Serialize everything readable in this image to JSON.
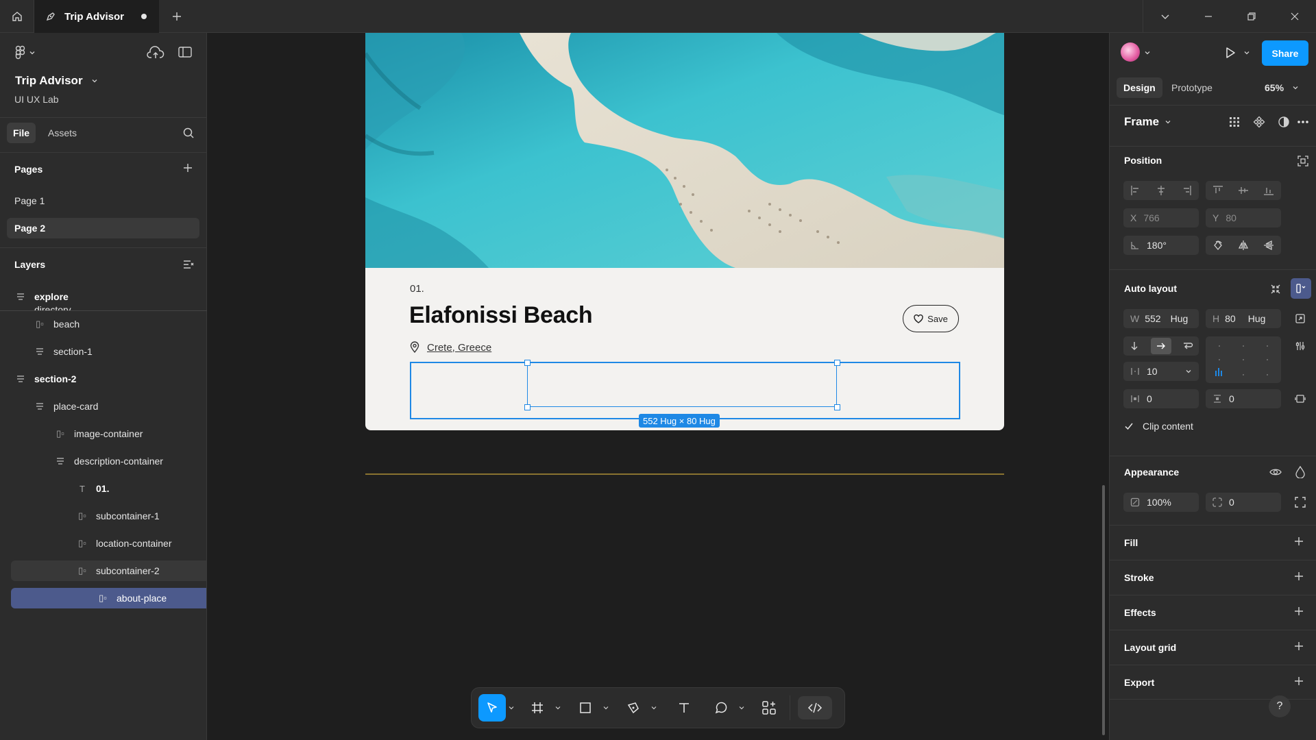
{
  "tab": {
    "title": "Trip Advisor"
  },
  "left_panel": {
    "project_name": "Trip Advisor",
    "team_name": "UI UX Lab",
    "file_tab": "File",
    "assets_tab": "Assets",
    "pages_heading": "Pages",
    "pages": [
      {
        "label": "Page 1",
        "active": false
      },
      {
        "label": "Page 2",
        "active": true
      }
    ],
    "layers_heading": "Layers",
    "layers": [
      {
        "label": "explore",
        "icon": "frame-icon"
      },
      {
        "label": "directory",
        "icon": "frame-icon"
      },
      {
        "label": "beach",
        "icon": "autolayout-icon"
      },
      {
        "label": "section-1",
        "icon": "frame-icon"
      },
      {
        "label": "section-2",
        "icon": "frame-icon"
      },
      {
        "label": "place-card",
        "icon": "frame-icon"
      },
      {
        "label": "image-container",
        "icon": "autolayout-icon"
      },
      {
        "label": "description-container",
        "icon": "frame-icon"
      },
      {
        "label": "01.",
        "icon": "text-icon"
      },
      {
        "label": "subcontainer-1",
        "icon": "autolayout-icon"
      },
      {
        "label": "location-container",
        "icon": "autolayout-icon"
      },
      {
        "label": "subcontainer-2",
        "icon": "autolayout-icon"
      },
      {
        "label": "about-place",
        "icon": "autolayout-icon"
      }
    ]
  },
  "canvas": {
    "card_number": "01.",
    "card_title": "Elafonissi Beach",
    "location": "Crete, Greece",
    "save_label": "Save",
    "size_badge": "552 Hug × 80 Hug"
  },
  "right_panel": {
    "share_label": "Share",
    "design_tab": "Design",
    "prototype_tab": "Prototype",
    "zoom": "65%",
    "frame_label": "Frame",
    "position_heading": "Position",
    "x_label": "X",
    "x_value": "766",
    "y_label": "Y",
    "y_value": "80",
    "rotation": "180°",
    "auto_layout_heading": "Auto layout",
    "w_label": "W",
    "w_value": "552",
    "w_mode": "Hug",
    "h_label": "H",
    "h_value": "80",
    "h_mode": "Hug",
    "gap_value": "10",
    "pad_h_value": "0",
    "pad_v_value": "0",
    "clip_content_label": "Clip content",
    "appearance_heading": "Appearance",
    "opacity_value": "100%",
    "radius_value": "0",
    "sections": [
      "Fill",
      "Stroke",
      "Effects",
      "Layout grid",
      "Export"
    ],
    "help": "?"
  },
  "colors": {
    "accent": "#0d99ff",
    "selection": "#1e88e5",
    "canvas": "#1e1e1e",
    "panel": "#2c2c2c"
  }
}
